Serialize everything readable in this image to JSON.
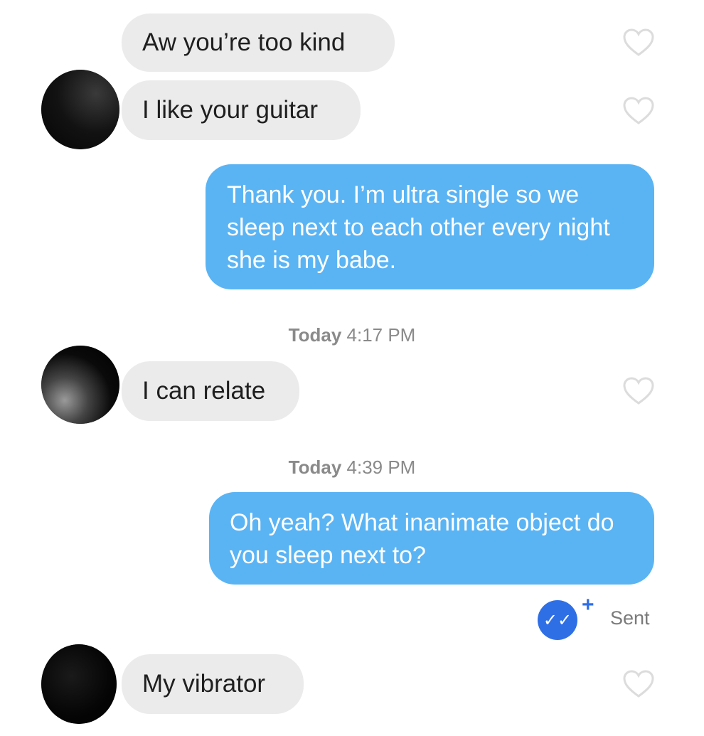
{
  "messages": {
    "m1": "Aw you’re too kind",
    "m2": "I like your guitar",
    "m3": "Thank you. I’m ultra single so we sleep next to each other every night she is my babe.",
    "m4": "I can relate",
    "m5": "Oh yeah? What inanimate object do you sleep next to?",
    "m6": "My vibrator"
  },
  "timestamps": {
    "t1_day": "Today",
    "t1_time": "4:17 PM",
    "t2_day": "Today",
    "t2_time": "4:39 PM"
  },
  "status": {
    "check_glyph": "✓✓",
    "plus_glyph": "+",
    "sent": "Sent"
  },
  "colors": {
    "incoming_bubble": "#ebebeb",
    "outgoing_bubble": "#5ab4f4",
    "read_receipt": "#2f6fe6"
  }
}
